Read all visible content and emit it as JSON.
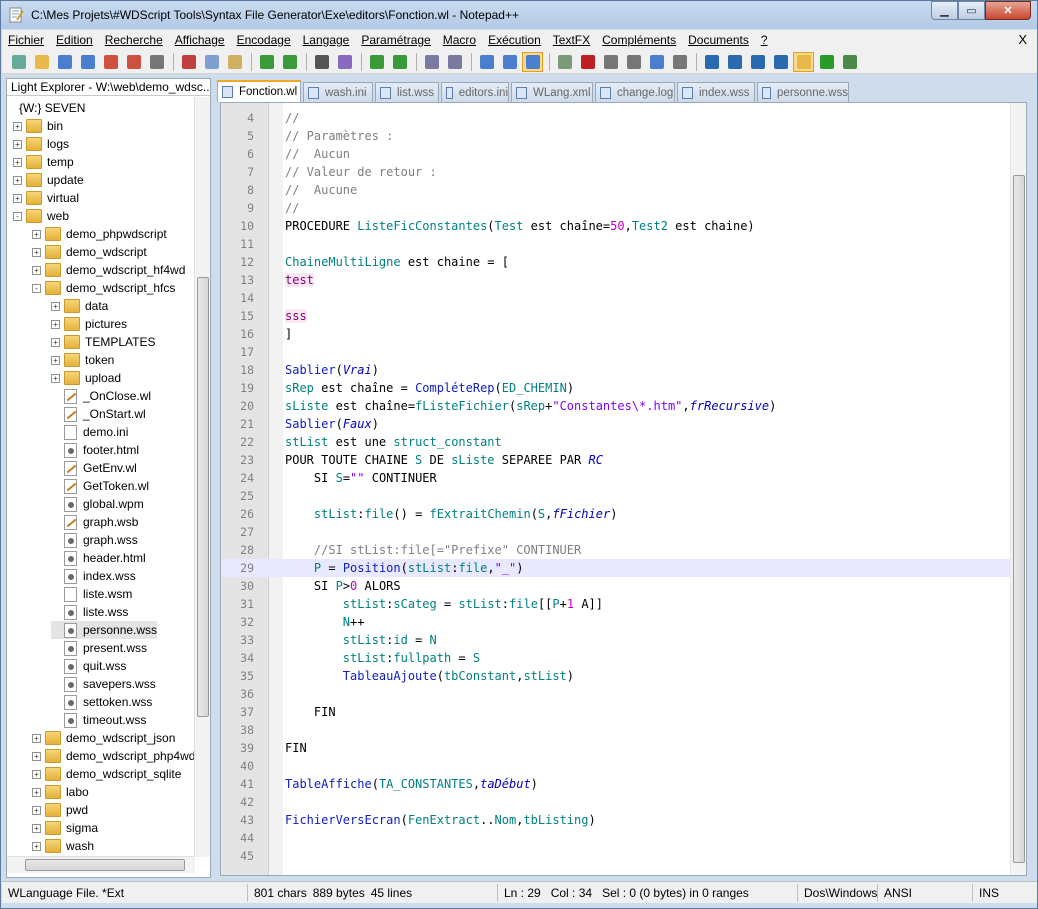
{
  "window": {
    "title": "C:\\Mes Projets\\#WDScript Tools\\Syntax File Generator\\Exe\\editors\\Fonction.wl - Notepad++"
  },
  "menu": [
    "Fichier",
    "Edition",
    "Recherche",
    "Affichage",
    "Encodage",
    "Langage",
    "Paramétrage",
    "Macro",
    "Exécution",
    "TextFX",
    "Compléments",
    "Documents",
    "?"
  ],
  "menu_close": "X",
  "toolbar_icons": [
    "new-icon",
    "open-icon",
    "save-icon",
    "save-all-icon",
    "close-icon",
    "close-all-icon",
    "print-icon",
    "cut-icon",
    "copy-icon",
    "paste-icon",
    "undo-icon",
    "redo-icon",
    "find-icon",
    "replace-icon",
    "zoom-in-icon",
    "zoom-out-icon",
    "sync-v-icon",
    "sync-h-icon",
    "wrap-icon",
    "all-chars-icon",
    "indent-guide-icon",
    "doc-map-icon",
    "record-macro-icon",
    "stop-macro-icon",
    "play-macro-icon",
    "run-macro-icon",
    "save-macro-icon",
    "trim-icon",
    "up-icon",
    "down-icon",
    "func-list-icon",
    "folder-panel-icon",
    "run-icon",
    "spellcheck-icon"
  ],
  "explorer": {
    "title": "Light Explorer - W:\\web\\demo_wdsc...",
    "close": "✕",
    "items": [
      {
        "label": "{W:} SEVEN",
        "type": "drive",
        "depth": 0,
        "exp": ""
      },
      {
        "label": "bin",
        "type": "folder",
        "depth": 1,
        "exp": "+"
      },
      {
        "label": "logs",
        "type": "folder",
        "depth": 1,
        "exp": "+"
      },
      {
        "label": "temp",
        "type": "folder",
        "depth": 1,
        "exp": "+"
      },
      {
        "label": "update",
        "type": "folder",
        "depth": 1,
        "exp": "+"
      },
      {
        "label": "virtual",
        "type": "folder",
        "depth": 1,
        "exp": "+"
      },
      {
        "label": "web",
        "type": "folder",
        "depth": 1,
        "exp": "-"
      },
      {
        "label": "demo_phpwdscript",
        "type": "folder",
        "depth": 2,
        "exp": "+"
      },
      {
        "label": "demo_wdscript",
        "type": "folder",
        "depth": 2,
        "exp": "+"
      },
      {
        "label": "demo_wdscript_hf4wd",
        "type": "folder",
        "depth": 2,
        "exp": "+"
      },
      {
        "label": "demo_wdscript_hfcs",
        "type": "folder",
        "depth": 2,
        "exp": "-"
      },
      {
        "label": "data",
        "type": "folder",
        "depth": 3,
        "exp": "+"
      },
      {
        "label": "pictures",
        "type": "folder",
        "depth": 3,
        "exp": "+"
      },
      {
        "label": "TEMPLATES",
        "type": "folder",
        "depth": 3,
        "exp": "+"
      },
      {
        "label": "token",
        "type": "folder",
        "depth": 3,
        "exp": "+"
      },
      {
        "label": "upload",
        "type": "folder",
        "depth": 3,
        "exp": "+"
      },
      {
        "label": "_OnClose.wl",
        "type": "edit",
        "depth": 3,
        "exp": ""
      },
      {
        "label": "_OnStart.wl",
        "type": "edit",
        "depth": 3,
        "exp": ""
      },
      {
        "label": "demo.ini",
        "type": "file",
        "depth": 3,
        "exp": ""
      },
      {
        "label": "footer.html",
        "type": "gear",
        "depth": 3,
        "exp": ""
      },
      {
        "label": "GetEnv.wl",
        "type": "edit",
        "depth": 3,
        "exp": ""
      },
      {
        "label": "GetToken.wl",
        "type": "edit",
        "depth": 3,
        "exp": ""
      },
      {
        "label": "global.wpm",
        "type": "gear",
        "depth": 3,
        "exp": ""
      },
      {
        "label": "graph.wsb",
        "type": "edit",
        "depth": 3,
        "exp": ""
      },
      {
        "label": "graph.wss",
        "type": "gear",
        "depth": 3,
        "exp": ""
      },
      {
        "label": "header.html",
        "type": "gear",
        "depth": 3,
        "exp": ""
      },
      {
        "label": "index.wss",
        "type": "gear",
        "depth": 3,
        "exp": ""
      },
      {
        "label": "liste.wsm",
        "type": "file",
        "depth": 3,
        "exp": ""
      },
      {
        "label": "liste.wss",
        "type": "gear",
        "depth": 3,
        "exp": ""
      },
      {
        "label": "personne.wss",
        "type": "gear",
        "depth": 3,
        "exp": "",
        "selected": true
      },
      {
        "label": "present.wss",
        "type": "gear",
        "depth": 3,
        "exp": ""
      },
      {
        "label": "quit.wss",
        "type": "gear",
        "depth": 3,
        "exp": ""
      },
      {
        "label": "savepers.wss",
        "type": "gear",
        "depth": 3,
        "exp": ""
      },
      {
        "label": "settoken.wss",
        "type": "gear",
        "depth": 3,
        "exp": ""
      },
      {
        "label": "timeout.wss",
        "type": "gear",
        "depth": 3,
        "exp": ""
      },
      {
        "label": "demo_wdscript_json",
        "type": "folder",
        "depth": 2,
        "exp": "+"
      },
      {
        "label": "demo_wdscript_php4wd",
        "type": "folder",
        "depth": 2,
        "exp": "+"
      },
      {
        "label": "demo_wdscript_sqlite",
        "type": "folder",
        "depth": 2,
        "exp": "+"
      },
      {
        "label": "labo",
        "type": "folder",
        "depth": 2,
        "exp": "+"
      },
      {
        "label": "pwd",
        "type": "folder",
        "depth": 2,
        "exp": "+"
      },
      {
        "label": "sigma",
        "type": "folder",
        "depth": 2,
        "exp": "+"
      },
      {
        "label": "wash",
        "type": "folder",
        "depth": 2,
        "exp": "+"
      }
    ]
  },
  "tabs": [
    "Fonction.wl",
    "wash.ini",
    "list.wss",
    "editors.ini",
    "WLang.xml",
    "change.log",
    "index.wss",
    "personne.wss"
  ],
  "code": [
    {
      "n": "4",
      "h": "<span class='c-com'>//</span>"
    },
    {
      "n": "5",
      "h": "<span class='c-com'>// Paramètres :</span>"
    },
    {
      "n": "6",
      "h": "<span class='c-com'>//  Aucun</span>"
    },
    {
      "n": "7",
      "h": "<span class='c-com'>// Valeur de retour :</span>"
    },
    {
      "n": "8",
      "h": "<span class='c-com'>//  Aucune</span>"
    },
    {
      "n": "9",
      "h": "<span class='c-com'>//</span>"
    },
    {
      "n": "10",
      "h": "PROCEDURE <span class='c-var'>ListeFicConstantes</span>(<span class='c-var'>Test</span> est chaîne=<span class='c-num'>50</span>,<span class='c-var'>Test2</span> est chaine)"
    },
    {
      "n": "11",
      "h": ""
    },
    {
      "n": "12",
      "h": "<span class='c-var'>ChaineMultiLigne</span> est chaine = ["
    },
    {
      "n": "13",
      "h": "<span class='c-pk c-hl'>test</span>"
    },
    {
      "n": "14",
      "h": ""
    },
    {
      "n": "15",
      "h": "<span class='c-pk c-hl'>sss</span>"
    },
    {
      "n": "16",
      "h": "]"
    },
    {
      "n": "17",
      "h": ""
    },
    {
      "n": "18",
      "h": "<span class='c-fn'>Sablier</span>(<span class='c-it'>Vrai</span>)"
    },
    {
      "n": "19",
      "h": "<span class='c-var'>sRep</span> est chaîne = <span class='c-fn'>CompléteRep</span>(<span class='c-var'>ED_CHEMIN</span>)"
    },
    {
      "n": "20",
      "h": "<span class='c-var'>sListe</span> est chaîne=<span class='c-var'>fListeFichier</span>(<span class='c-var'>sRep</span>+<span class='c-str'>\"Constantes\\*.htm\"</span>,<span class='c-it'>frRecursive</span>)"
    },
    {
      "n": "21",
      "h": "<span class='c-fn'>Sablier</span>(<span class='c-it'>Faux</span>)"
    },
    {
      "n": "22",
      "h": "<span class='c-var'>stList</span> est une <span class='c-var'>struct_constant</span>"
    },
    {
      "n": "23",
      "h": "POUR TOUTE CHAINE <span class='c-var'>S</span> DE <span class='c-var'>sListe</span> SEPAREE PAR <span class='c-it'>RC</span>"
    },
    {
      "n": "24",
      "h": "    SI <span class='c-var'>S</span>=<span class='c-str'>\"\"</span> CONTINUER"
    },
    {
      "n": "25",
      "h": ""
    },
    {
      "n": "26",
      "h": "    <span class='c-var'>stList</span>:<span class='c-var'>file</span>() = <span class='c-var'>fExtraitChemin</span>(<span class='c-var'>S</span>,<span class='c-it'>fFichier</span>)"
    },
    {
      "n": "27",
      "h": ""
    },
    {
      "n": "28",
      "h": "    <span class='c-com'>//SI stList:file[=\"Prefixe\" CONTINUER</span>"
    },
    {
      "n": "29",
      "h": "    <span class='c-var'>P</span> = <span class='c-fn'>Position</span>(<span class='c-var'>stList</span>:<span class='c-var'>file</span>,<span class='c-str'>\"_\"</span>)",
      "cur": true
    },
    {
      "n": "30",
      "h": "    SI <span class='c-var'>P</span>><span class='c-num'>0</span> ALORS"
    },
    {
      "n": "31",
      "h": "        <span class='c-var'>stList</span>:<span class='c-var'>sCateg</span> = <span class='c-var'>stList</span>:<span class='c-var'>file</span>[[<span class='c-var'>P</span>+<span class='c-num'>1</span> A]]"
    },
    {
      "n": "32",
      "h": "        <span class='c-var'>N</span>++"
    },
    {
      "n": "33",
      "h": "        <span class='c-var'>stList</span>:<span class='c-var'>id</span> = <span class='c-var'>N</span>"
    },
    {
      "n": "34",
      "h": "        <span class='c-var'>stList</span>:<span class='c-var'>fullpath</span> = <span class='c-var'>S</span>"
    },
    {
      "n": "35",
      "h": "        <span class='c-fn'>TableauAjoute</span>(<span class='c-var'>tbConstant</span>,<span class='c-var'>stList</span>)"
    },
    {
      "n": "36",
      "h": ""
    },
    {
      "n": "37",
      "h": "    FIN"
    },
    {
      "n": "38",
      "h": ""
    },
    {
      "n": "39",
      "h": "FIN"
    },
    {
      "n": "40",
      "h": ""
    },
    {
      "n": "41",
      "h": "<span class='c-fn'>TableAffiche</span>(<span class='c-var'>TA_CONSTANTES</span>,<span class='c-it'>taDébut</span>)"
    },
    {
      "n": "42",
      "h": ""
    },
    {
      "n": "43",
      "h": "<span class='c-fn'>FichierVersEcran</span>(<span class='c-var'>FenExtract</span>..<span class='c-var'>Nom</span>,<span class='c-var'>tbListing</span>)"
    },
    {
      "n": "44",
      "h": ""
    },
    {
      "n": "45",
      "h": ""
    }
  ],
  "status": {
    "filetype": "WLanguage File. *Ext",
    "chars": "801 chars",
    "bytes": "889 bytes",
    "lines": "45 lines",
    "ln": "Ln : 29",
    "col": "Col : 34",
    "sel": "Sel : 0 (0 bytes) in 0 ranges",
    "eol": "Dos\\Windows",
    "enc": "ANSI",
    "mode": "INS"
  }
}
